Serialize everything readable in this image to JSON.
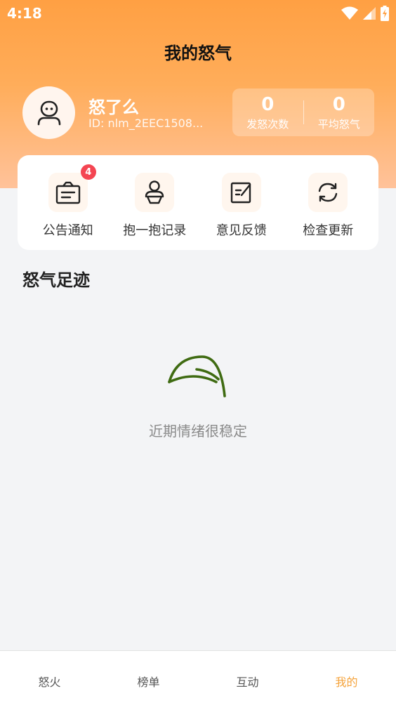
{
  "status": {
    "time": "4:18"
  },
  "header": {
    "title": "我的怒气"
  },
  "profile": {
    "name": "怒了么",
    "id": "ID: nlm_2EEC1508..."
  },
  "stats": [
    {
      "value": "0",
      "label": "发怒次数"
    },
    {
      "value": "0",
      "label": "平均怒气"
    }
  ],
  "menu": [
    {
      "label": "公告通知",
      "icon": "announcement-icon",
      "badge": "4"
    },
    {
      "label": "抱一抱记录",
      "icon": "hug-icon"
    },
    {
      "label": "意见反馈",
      "icon": "feedback-icon"
    },
    {
      "label": "检查更新",
      "icon": "refresh-icon"
    }
  ],
  "footprint": {
    "title": "怒气足迹",
    "empty_text": "近期情绪很稳定",
    "icon": "leaf-icon"
  },
  "tabs": [
    {
      "label": "怒火"
    },
    {
      "label": "榜单"
    },
    {
      "label": "互动"
    },
    {
      "label": "我的",
      "active": true
    }
  ],
  "colors": {
    "accent": "#f5a33b",
    "header_top": "#ffa043",
    "badge": "#f44552",
    "leaf": "#3f6b12"
  }
}
